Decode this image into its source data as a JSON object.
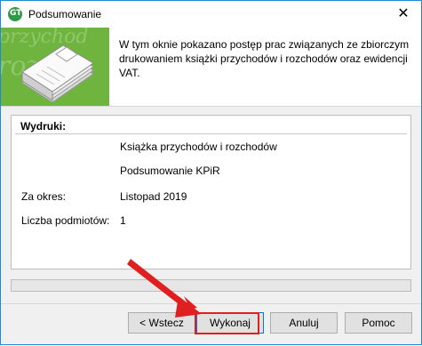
{
  "window": {
    "title": "Podsumowanie",
    "close_glyph": "✕",
    "app_icon": "gt-logo-icon",
    "app_icon_text": "GT"
  },
  "header": {
    "banner_watermark": [
      "przychod",
      "rozcho"
    ],
    "description": "W tym oknie pokazano postęp prac związanych ze zbiorczym drukowaniem książki przychodów i rozchodów oraz ewidencji VAT.",
    "illustration": "stacked-documents-icon",
    "banner_color": "#6eb43f"
  },
  "summary": {
    "group_title": "Wydruki:",
    "items": [
      "Książka przychodów i rozchodów",
      "Podsumowanie KPiR"
    ],
    "period_label": "Za okres:",
    "period_value": "Listopad 2019",
    "entities_label": "Liczba podmiotów:",
    "entities_value": "1"
  },
  "progress": {
    "value": 0,
    "color": "#06b025"
  },
  "buttons": {
    "back": "< Wstecz",
    "run": "Wykonaj",
    "cancel": "Anuluj",
    "help": "Pomoc"
  },
  "annotation": {
    "arrow_icon": "red-arrow-icon",
    "highlight_color": "#e02020"
  }
}
